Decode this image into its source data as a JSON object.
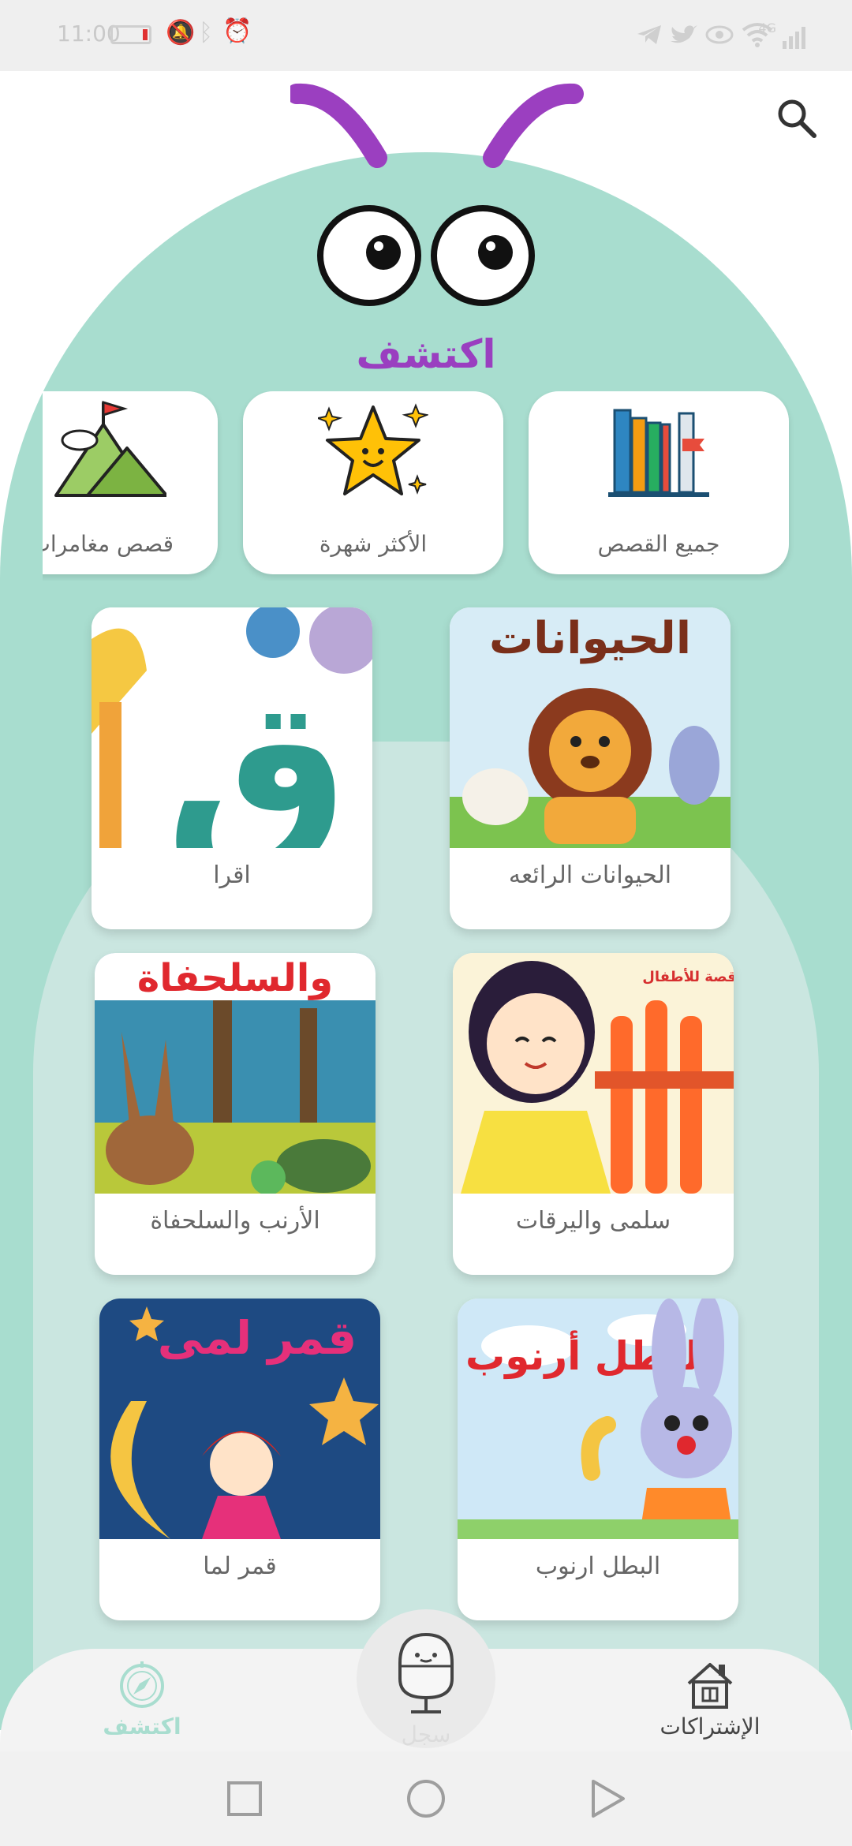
{
  "status_bar": {
    "time": "11:00",
    "icons": [
      "telegram-icon",
      "twitter-icon",
      "eye-icon",
      "wifi-icon",
      "signal-icon",
      "alarm-icon",
      "bluetooth-icon",
      "mute-icon",
      "battery-icon"
    ],
    "network": "4G"
  },
  "header": {
    "title": "اكتشف",
    "search_icon": "search-icon",
    "accent_color": "#9a3fc0",
    "body_color": "#a8ddcf"
  },
  "categories": [
    {
      "label": "جميع القصص",
      "icon": "books-icon"
    },
    {
      "label": "الأكثر شهرة",
      "icon": "star-icon"
    },
    {
      "label": "قصص مغامرات",
      "icon": "mountain-icon"
    }
  ],
  "stories": [
    {
      "title": "الحيوانات الرائعه",
      "cover_text": "الحيوانات"
    },
    {
      "title": "اقرا",
      "cover_text": "ق"
    },
    {
      "title": "سلمى واليرقات",
      "cover_text": "قصة للأطفال"
    },
    {
      "title": "الأرنب والسلحفاة",
      "cover_text": "والسلحفاة"
    },
    {
      "title": "البطل ارنوب",
      "cover_text": "البطل أرنوب"
    },
    {
      "title": "قمر لما",
      "cover_text": "قمر لمى"
    }
  ],
  "bottom_nav": {
    "items": [
      {
        "label": "الإشتراكات",
        "icon": "house-icon",
        "active": false
      },
      {
        "label": "سجل",
        "icon": "microphone-icon",
        "active": false
      },
      {
        "label": "اكتشف",
        "icon": "compass-icon",
        "active": true
      }
    ],
    "active_color": "#a8ddcf"
  },
  "system_nav": [
    "back-icon",
    "home-icon",
    "recents-icon"
  ]
}
